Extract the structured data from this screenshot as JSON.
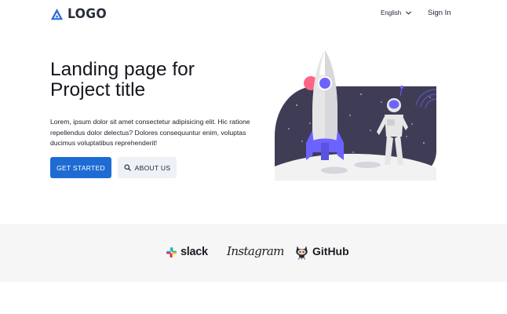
{
  "header": {
    "logo_text": "LOGO",
    "language": "English",
    "signin_label": "Sign In"
  },
  "hero": {
    "title": "Landing page for Project title",
    "description": "Lorem, ipsum dolor sit amet consectetur adipisicing elit. Hic ratione repellendus dolor delectus? Dolores consequuntur enim, voluptas ducimus voluptatibus reprehenderit!",
    "primary_button": "GET STARTED",
    "secondary_button": "ABOUT US"
  },
  "brands": {
    "slack": "slack",
    "instagram": "Instagram",
    "github": "GitHub"
  },
  "colors": {
    "primary": "#1e6cd3",
    "illustration_purple": "#6c63ff",
    "illustration_night": "#3f3d56",
    "brands_background": "#f6f6f7"
  },
  "icons": {
    "logo": "triangle-logo-icon",
    "language": "chevron-down-icon",
    "about": "search-icon",
    "slack": "slack-logo-icon",
    "github": "octocat-icon"
  }
}
